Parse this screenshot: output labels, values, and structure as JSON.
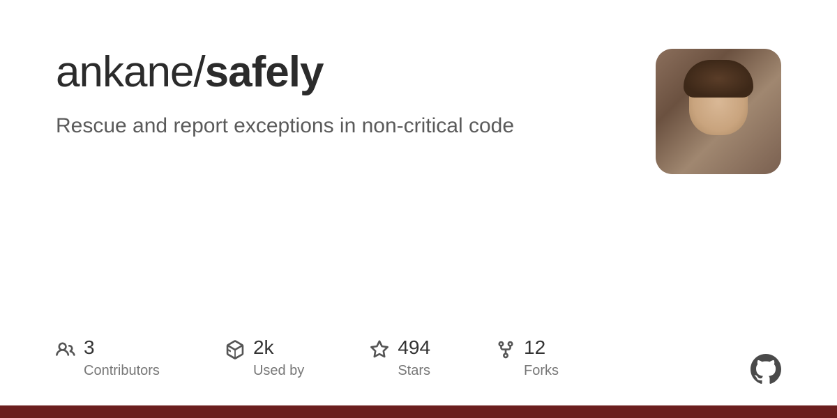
{
  "repo": {
    "owner": "ankane",
    "name": "safely",
    "description": "Rescue and report exceptions in non-critical code"
  },
  "stats": {
    "contributors": {
      "value": "3",
      "label": "Contributors"
    },
    "used_by": {
      "value": "2k",
      "label": "Used by"
    },
    "stars": {
      "value": "494",
      "label": "Stars"
    },
    "forks": {
      "value": "12",
      "label": "Forks"
    }
  },
  "colors": {
    "accent_bar": "#6b1e1e"
  }
}
